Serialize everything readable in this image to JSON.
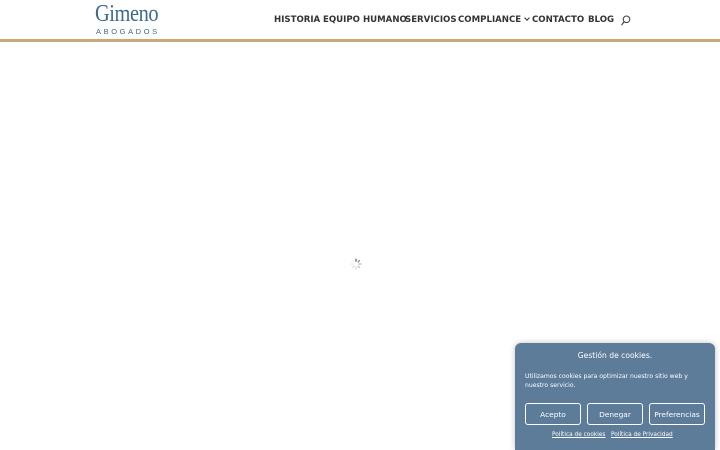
{
  "brand": {
    "name": "Gimeno",
    "subtitle": "ABOGADOS",
    "color": "#3e6a8d",
    "accent": "#c9a97a"
  },
  "nav": {
    "items": [
      {
        "label": "HISTORIA"
      },
      {
        "label": "EQUIPO HUMANO"
      },
      {
        "label": "SERVICIOS"
      },
      {
        "label": "COMPLIANCE",
        "has_submenu": true
      },
      {
        "label": "CONTACTO"
      },
      {
        "label": "BLOG"
      }
    ],
    "search_icon": "search-icon"
  },
  "main": {
    "loading_icon": "spinner-icon"
  },
  "cookie_banner": {
    "title": "Gestión de cookies.",
    "message": "Utilizamos cookies para optimizar nuestro sitio web y nuestro servicio.",
    "accept_label": "Acepto",
    "deny_label": "Denegar",
    "preferences_label": "Preferencias",
    "cookie_policy_link": "Política de cookies",
    "privacy_policy_link": "Política de Privacidad",
    "background": "#5d7c99"
  }
}
